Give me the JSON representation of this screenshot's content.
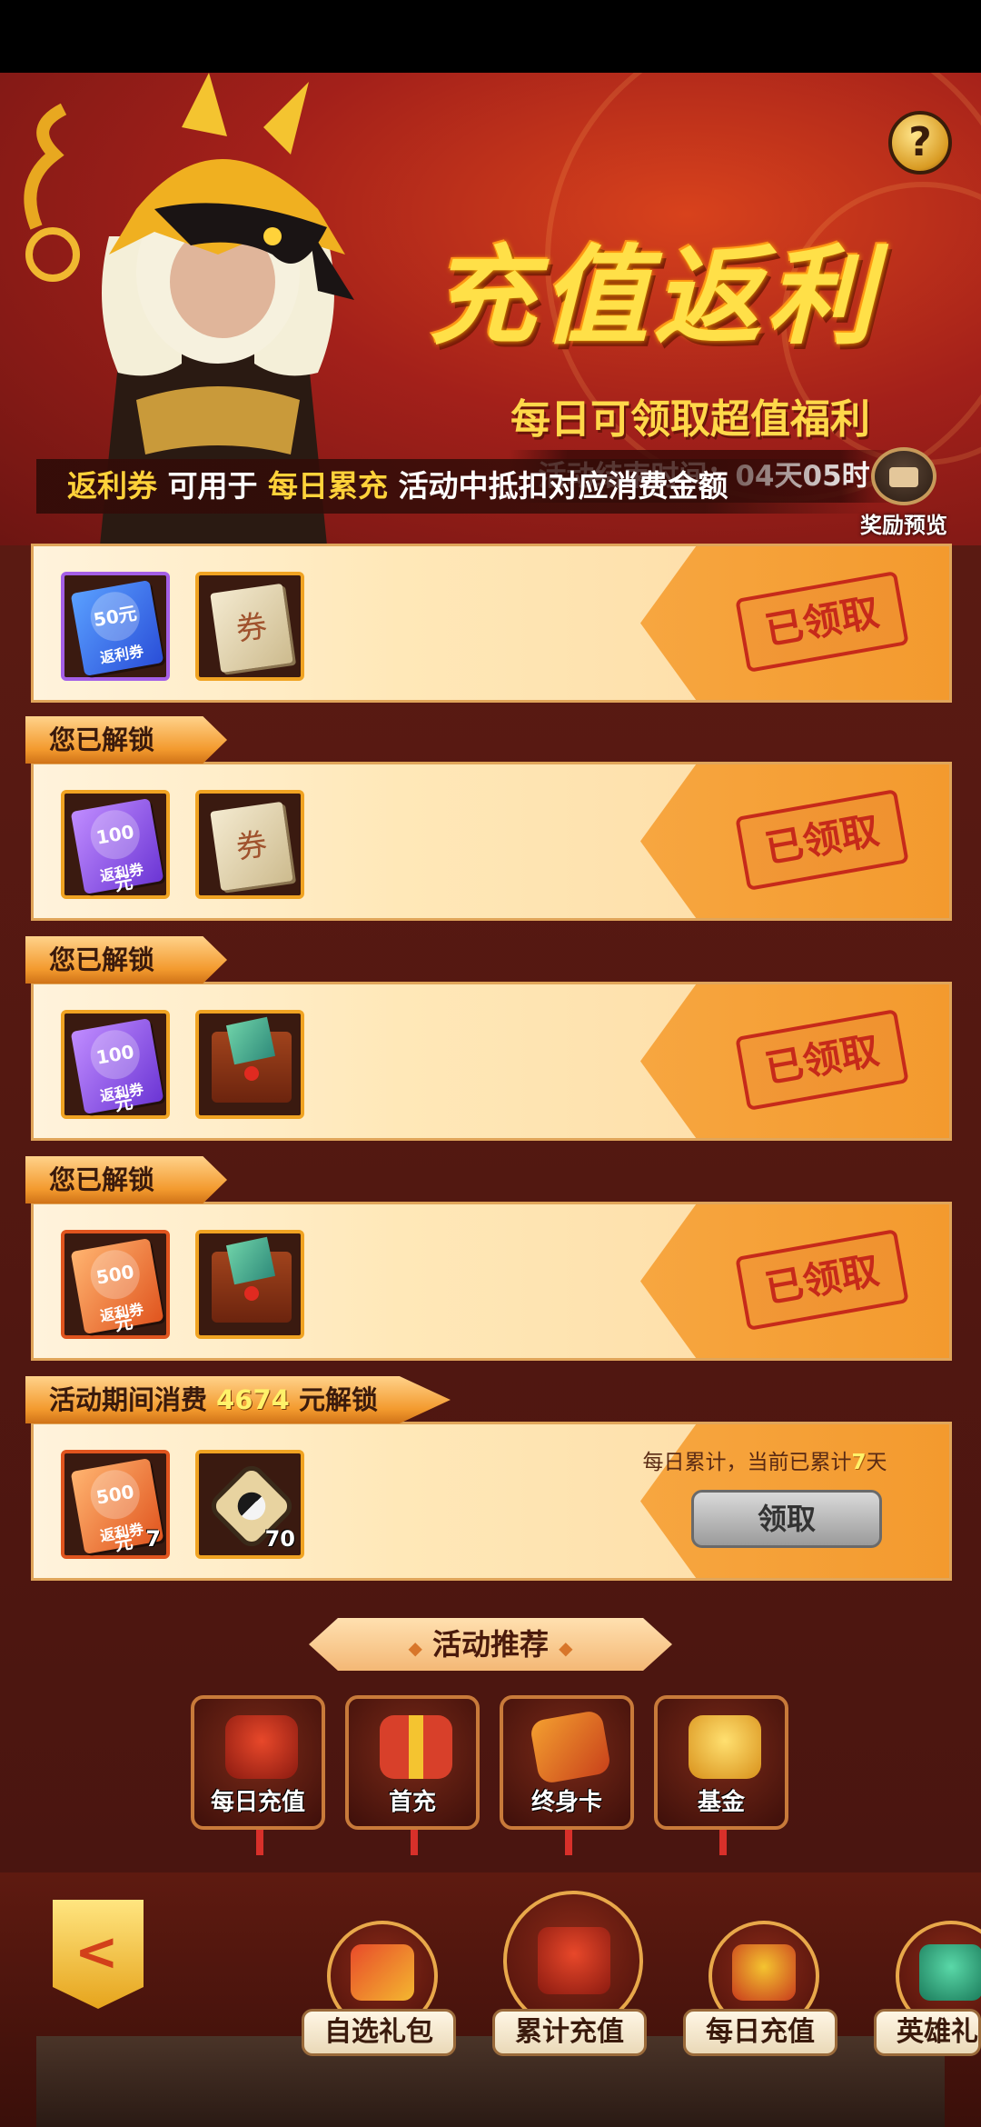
{
  "header": {
    "title": "充值返利",
    "subtitle": "每日可领取超值福利",
    "timer": "活动结束时间：04天05时",
    "help_symbol": "?"
  },
  "info_bar": {
    "part1": "返利券",
    "part2": " 可用于 ",
    "part3": "每日累充",
    "part4": " 活动中抵扣对应消费金额"
  },
  "reward_preview_label": "奖励预览",
  "tiers": [
    {
      "ribbon": "",
      "items": [
        {
          "type": "ticket",
          "color": "blue",
          "amount": "50元",
          "name": "返利券"
        },
        {
          "type": "scroll",
          "glyph": "券"
        }
      ],
      "status": "已领取"
    },
    {
      "ribbon": "您已解锁",
      "items": [
        {
          "type": "ticket",
          "color": "purple",
          "amount": "100元",
          "name": "返利券"
        },
        {
          "type": "scroll",
          "glyph": "券"
        }
      ],
      "status": "已领取"
    },
    {
      "ribbon": "您已解锁",
      "items": [
        {
          "type": "ticket",
          "color": "purple",
          "amount": "100元",
          "name": "返利券"
        },
        {
          "type": "envelope"
        }
      ],
      "status": "已领取"
    },
    {
      "ribbon": "您已解锁",
      "items": [
        {
          "type": "ticket",
          "color": "orange",
          "amount": "500元",
          "name": "返利券"
        },
        {
          "type": "envelope"
        }
      ],
      "status": "已领取"
    },
    {
      "ribbon_prefix": "活动期间消费",
      "ribbon_amount": "4674",
      "ribbon_suffix": "元解锁",
      "items": [
        {
          "type": "ticket",
          "color": "orange",
          "amount": "500元",
          "name": "返利券",
          "count": "7"
        },
        {
          "type": "taiji",
          "count": "70"
        }
      ],
      "progress_prefix": "每日累计，当前已累计",
      "progress_days": "7",
      "progress_suffix": "天",
      "button": "领取"
    }
  ],
  "recommend": {
    "title": "活动推荐",
    "items": [
      {
        "label": "每日充值",
        "icon": "red-pouch-icon",
        "color": "#c4301e"
      },
      {
        "label": "首充",
        "icon": "gift-box-icon",
        "color": "#d8402a"
      },
      {
        "label": "终身卡",
        "icon": "card-icon",
        "color": "#e06a1a"
      },
      {
        "label": "基金",
        "icon": "gold-ingot-icon",
        "color": "#e8a820"
      }
    ]
  },
  "dock": {
    "back_symbol": "<",
    "items": [
      {
        "label": "自选礼包",
        "color": "#d83a2a"
      },
      {
        "label": "累计充值",
        "color": "#c4301e"
      },
      {
        "label": "每日充值",
        "color": "#b82a1c"
      },
      {
        "label": "英雄礼",
        "color": "#2aa07a"
      }
    ]
  }
}
